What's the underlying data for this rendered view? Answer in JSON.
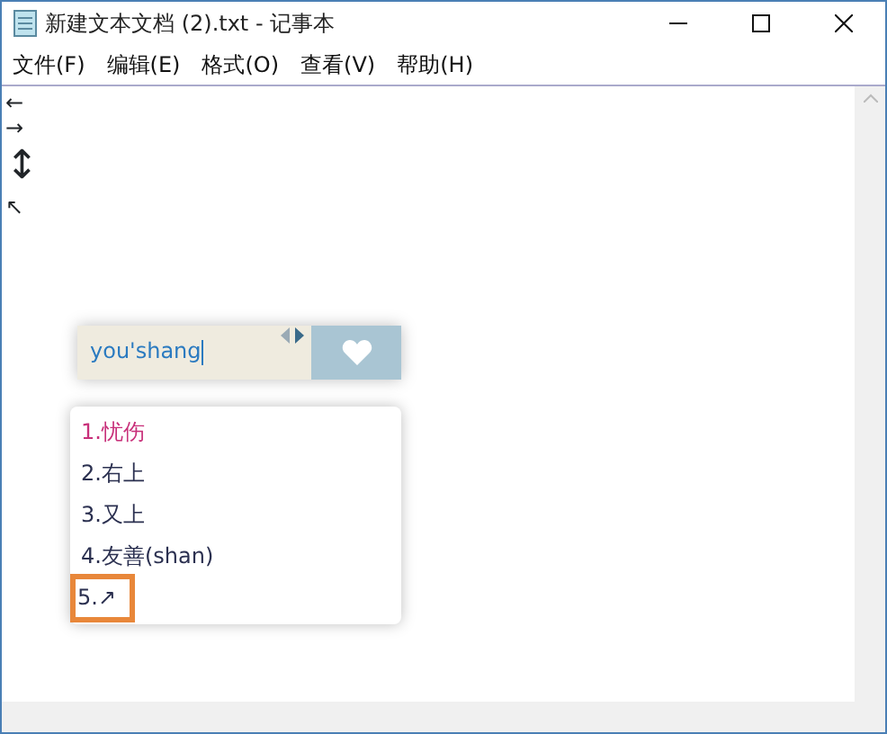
{
  "window": {
    "title": "新建文本文档 (2).txt - 记事本"
  },
  "menu": [
    "文件(F)",
    "编辑(E)",
    "格式(O)",
    "查看(V)",
    "帮助(H)"
  ],
  "document": {
    "lines": [
      "←",
      "→",
      "↕",
      "↖"
    ]
  },
  "ime": {
    "input": "you'shang",
    "candidates": [
      {
        "text": "1.忧伤",
        "selected": true,
        "outlined": false
      },
      {
        "text": "2.右上",
        "selected": false,
        "outlined": false
      },
      {
        "text": "3.又上",
        "selected": false,
        "outlined": false
      },
      {
        "text": "4.友善(shan)",
        "selected": false,
        "outlined": false
      },
      {
        "text": "5.↗",
        "selected": false,
        "outlined": true
      }
    ]
  }
}
